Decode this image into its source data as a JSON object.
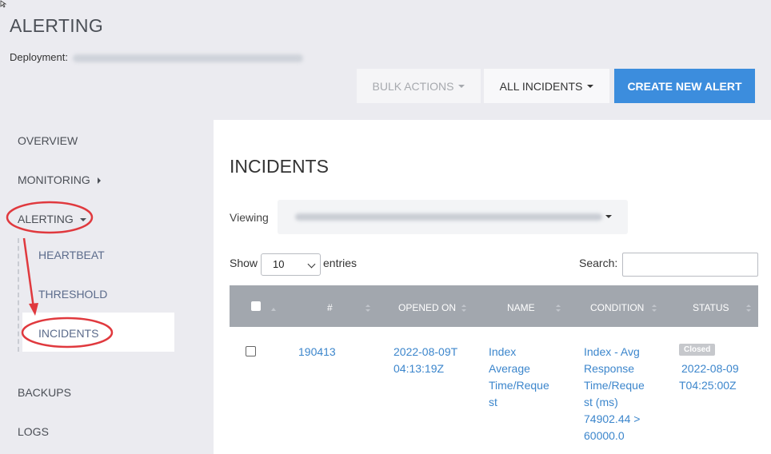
{
  "header": {
    "title": "ALERTING",
    "deployment_label": "Deployment:"
  },
  "toolbar": {
    "bulk_actions": "BULK ACTIONS",
    "all_incidents": "ALL INCIDENTS",
    "create_alert": "CREATE NEW ALERT"
  },
  "sidebar": {
    "items": {
      "overview": "OVERVIEW",
      "monitoring": "MONITORING",
      "alerting": "ALERTING",
      "backups": "BACKUPS",
      "logs": "LOGS"
    },
    "alerting_sub": {
      "heartbeat": "HEARTBEAT",
      "threshold": "THRESHOLD",
      "incidents": "INCIDENTS"
    }
  },
  "main": {
    "title": "INCIDENTS",
    "viewing_label": "Viewing",
    "show_label": "Show",
    "show_value": "10",
    "entries_label": "entries",
    "search_label": "Search:",
    "search_value": ""
  },
  "table": {
    "headers": {
      "number": "#",
      "opened_on": "OPENED ON",
      "name": "NAME",
      "condition": "CONDITION",
      "status": "STATUS"
    },
    "row": {
      "number": "190413",
      "opened_on_1": "2022-08-09T",
      "opened_on_2": "04:13:19Z",
      "name_1": "Index",
      "name_2": "Average",
      "name_3": "Time/Reque",
      "name_4": "st",
      "cond_1": "Index - Avg",
      "cond_2": "Response",
      "cond_3": "Time/Reque",
      "cond_4": "st (ms)",
      "cond_5": "74902.44 >",
      "cond_6": "60000.0",
      "status_badge": "Closed",
      "closed_1": "2022-08-09",
      "closed_2": "T04:25:00Z"
    }
  },
  "colors": {
    "accent": "#3c8ddd",
    "link": "#3c86cc",
    "annotation": "#e0393e",
    "table_header": "#a2a7ae"
  },
  "icons": [
    "caret-down-icon",
    "caret-right-icon",
    "sort-icon",
    "checkbox-icon",
    "cursor-icon"
  ]
}
